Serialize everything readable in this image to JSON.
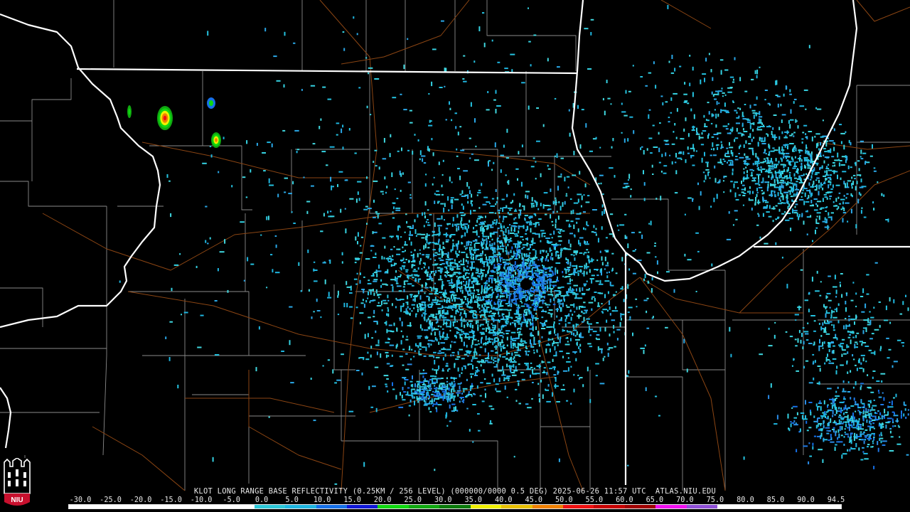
{
  "product_title": "KLOT LONG RANGE BASE REFLECTIVITY (0.25KM / 256 LEVEL) (000000/0000 0.5 DEG) 2025-06-26 11:57 UTC  ATLAS.NIU.EDU",
  "legend": {
    "ticks": [
      "-30.0",
      "-25.0",
      "-20.0",
      "-15.0",
      "-10.0",
      "-5.0",
      "0.0",
      "5.0",
      "10.0",
      "15.0",
      "20.0",
      "25.0",
      "30.0",
      "35.0",
      "40.0",
      "45.0",
      "50.0",
      "55.0",
      "60.0",
      "65.0",
      "70.0",
      "75.0",
      "80.0",
      "85.0",
      "90.0",
      "94.5"
    ],
    "colors": [
      "#ffffff",
      "#ffffff",
      "#ffffff",
      "#ffffff",
      "#ffffff",
      "#ffffff",
      "#2dc8d8",
      "#1fb6e0",
      "#1670e8",
      "#1018d8",
      "#10d810",
      "#10a810",
      "#0a7a0a",
      "#f0f000",
      "#e8c000",
      "#f08000",
      "#f01010",
      "#c80000",
      "#a00000",
      "#f010f0",
      "#9050d8",
      "#ffffff",
      "#ffffff",
      "#ffffff",
      "#ffffff"
    ]
  },
  "logo": {
    "text": "NIU",
    "icon": "niu-logo-icon",
    "accent": "#c8102e"
  },
  "map": {
    "background": "#000000",
    "state_border_color": "#ffffff",
    "county_border_color": "#8a8a8a",
    "highway_color": "#8b4513",
    "radar_site": "KLOT"
  }
}
